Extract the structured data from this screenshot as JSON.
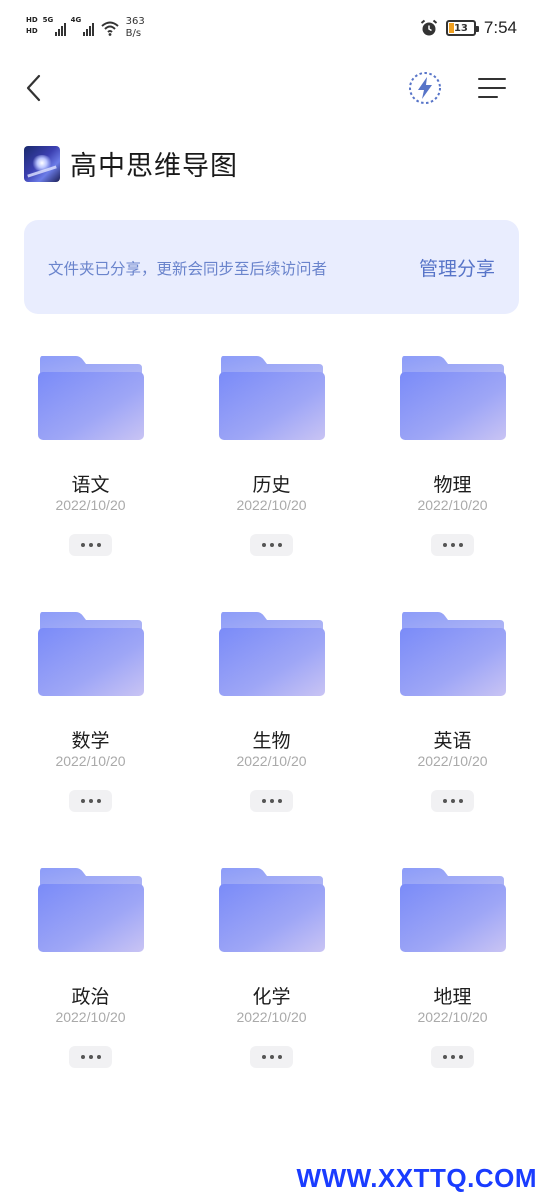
{
  "status_bar": {
    "sim1": "HD",
    "sim2": "HD",
    "signal1_label": "5G",
    "signal2_label": "4G",
    "net_speed_value": "363",
    "net_speed_unit": "B/s",
    "battery_level": "13",
    "time": "7:54"
  },
  "toolbar": {
    "back_icon": "chevron-left-icon",
    "bolt_icon": "lightning-icon",
    "menu_icon": "menu-icon",
    "accent_color": "#5774c8"
  },
  "header": {
    "title": "高中思维导图"
  },
  "share_banner": {
    "message": "文件夹已分享，更新会同步至后续访问者",
    "action_label": "管理分享",
    "background": "#e9edfe"
  },
  "folders": [
    {
      "name": "语文",
      "date": "2022/10/20"
    },
    {
      "name": "历史",
      "date": "2022/10/20"
    },
    {
      "name": "物理",
      "date": "2022/10/20"
    },
    {
      "name": "数学",
      "date": "2022/10/20"
    },
    {
      "name": "生物",
      "date": "2022/10/20"
    },
    {
      "name": "英语",
      "date": "2022/10/20"
    },
    {
      "name": "政治",
      "date": "2022/10/20"
    },
    {
      "name": "化学",
      "date": "2022/10/20"
    },
    {
      "name": "地理",
      "date": "2022/10/20"
    }
  ],
  "watermark": "WWW.XXTTQ.COM"
}
